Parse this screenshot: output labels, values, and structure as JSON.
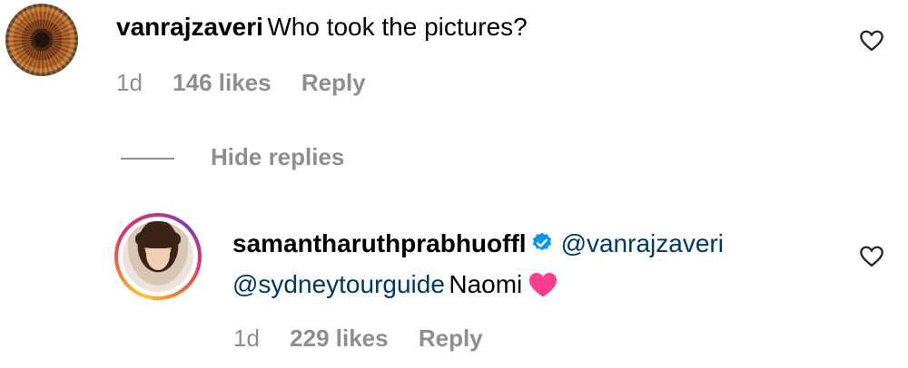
{
  "comment": {
    "username": "vanrajzaveri",
    "text": "Who took the pictures?",
    "age": "1d",
    "likes": "146 likes",
    "reply_label": "Reply"
  },
  "hide_replies_label": "Hide replies",
  "reply": {
    "username": "samantharuthprabhuoffl",
    "mention1": "@vanrajzaveri",
    "mention2": "@sydneytourguide",
    "text": "Naomi",
    "age": "1d",
    "likes": "229 likes",
    "reply_label": "Reply"
  },
  "colors": {
    "meta_gray": "#8e8e8e",
    "mention_blue": "#00376b",
    "verified_blue": "#0095f6",
    "heart_pink": "#ff3c8e"
  },
  "icons": {
    "like": "heart-outline-icon",
    "verified": "verified-badge-icon",
    "emoji": "pink-heart-emoji"
  }
}
